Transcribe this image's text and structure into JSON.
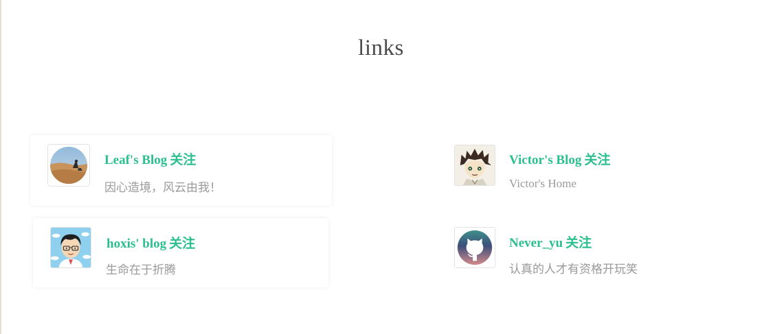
{
  "page": {
    "title": "links"
  },
  "links": [
    {
      "name": "Leaf's Blog",
      "follow_label": "关注",
      "description": "因心造境，风云由我！",
      "avatar_icon": "desert-photo-avatar-icon"
    },
    {
      "name": "Victor's Blog",
      "follow_label": "关注",
      "description": "Victor's Home",
      "avatar_icon": "anime-character-avatar-icon"
    },
    {
      "name": "hoxis' blog",
      "follow_label": "关注",
      "description": "生命在于折腾",
      "avatar_icon": "cartoon-boy-glasses-avatar-icon"
    },
    {
      "name": "Never_yu",
      "follow_label": "关注",
      "description": "认真的人才有资格开玩笑",
      "avatar_icon": "github-octocat-avatar-icon"
    }
  ],
  "colors": {
    "link_name": "#2bbf8c",
    "description": "#9a9a9a",
    "title": "#4a4a4a"
  }
}
